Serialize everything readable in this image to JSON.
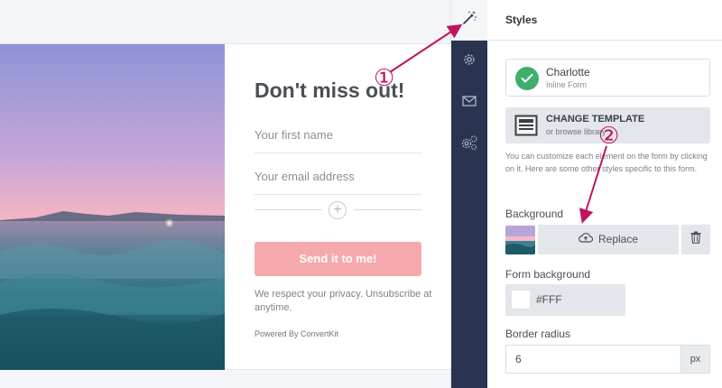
{
  "form_preview": {
    "headline": "Don't miss out!",
    "first_name_placeholder": "Your first name",
    "email_placeholder": "Your email address",
    "add_field_symbol": "+",
    "submit_label": "Send it to me!",
    "privacy_text": "We respect your privacy. Unsubscribe at anytime.",
    "powered_by": "Powered By ConvertKit"
  },
  "rail": {
    "items": [
      {
        "icon": "magic-wand-icon",
        "active": true
      },
      {
        "icon": "gear-icon",
        "active": false
      },
      {
        "icon": "envelope-icon",
        "active": false
      },
      {
        "icon": "integrations-gear-icon",
        "active": false
      }
    ]
  },
  "panel": {
    "title": "Styles",
    "template": {
      "name": "Charlotte",
      "type": "Inline Form"
    },
    "change_template": {
      "title": "CHANGE TEMPLATE",
      "subtitle": "or browse library"
    },
    "help_text": "You can customize each element on the form by clicking on it. Here are some other styles specific to this form.",
    "background": {
      "label": "Background",
      "replace_label": "Replace"
    },
    "form_background": {
      "label": "Form background",
      "value": "#FFF"
    },
    "border_radius": {
      "label": "Border radius",
      "value": "6",
      "unit": "px"
    }
  },
  "annotations": {
    "callout_1": "①",
    "callout_2": "②"
  },
  "colors": {
    "rail_bg": "#2a3350",
    "submit_button": "#f6a9ac",
    "check_green": "#3fae6e",
    "callout": "#c0145e"
  }
}
